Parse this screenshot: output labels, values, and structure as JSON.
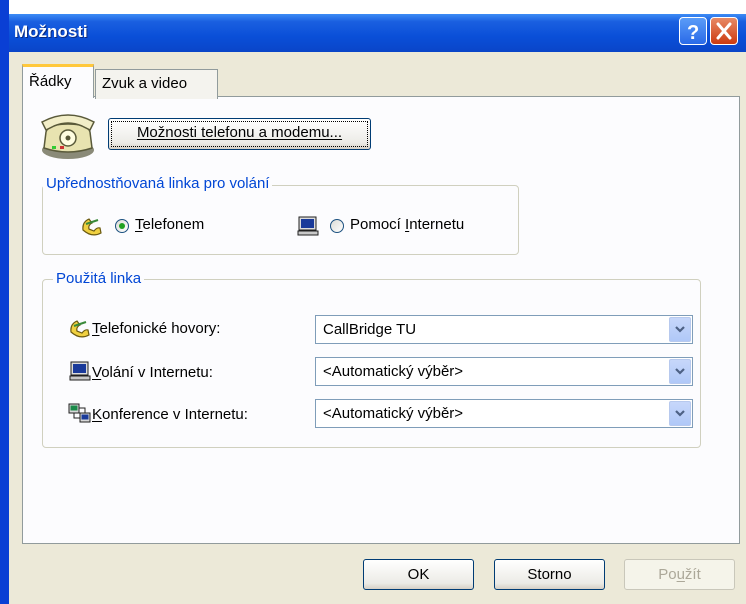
{
  "window": {
    "title": "Možnosti"
  },
  "tabs": [
    {
      "label": "Řádky",
      "active": true
    },
    {
      "label": "Zvuk a video",
      "active": false
    }
  ],
  "modem_button": {
    "label": "Možnosti telefonu a modemu..."
  },
  "preferred_group": {
    "legend": "Upřednostňovaná linka pro volání",
    "options": [
      {
        "label": "Telefonem",
        "selected": true
      },
      {
        "label": "Pomocí Internetu",
        "selected": false
      }
    ]
  },
  "used_line_group": {
    "legend": "Použitá linka",
    "rows": [
      {
        "label": "Telefonické hovory:",
        "value": "CallBridge TU",
        "icon": "phone-handset-icon"
      },
      {
        "label": "Volání v Internetu:",
        "value": "<Automatický výběr>",
        "icon": "computer-icon"
      },
      {
        "label": "Konference v Internetu:",
        "value": "<Automatický výběr>",
        "icon": "conference-icon"
      }
    ]
  },
  "buttons": {
    "ok": "OK",
    "storno": "Storno",
    "pouzit": "Použít"
  },
  "colors": {
    "titlebar": "#0a4fd8",
    "legend": "#0046d5",
    "active_tab_accent": "#ffc83c"
  }
}
